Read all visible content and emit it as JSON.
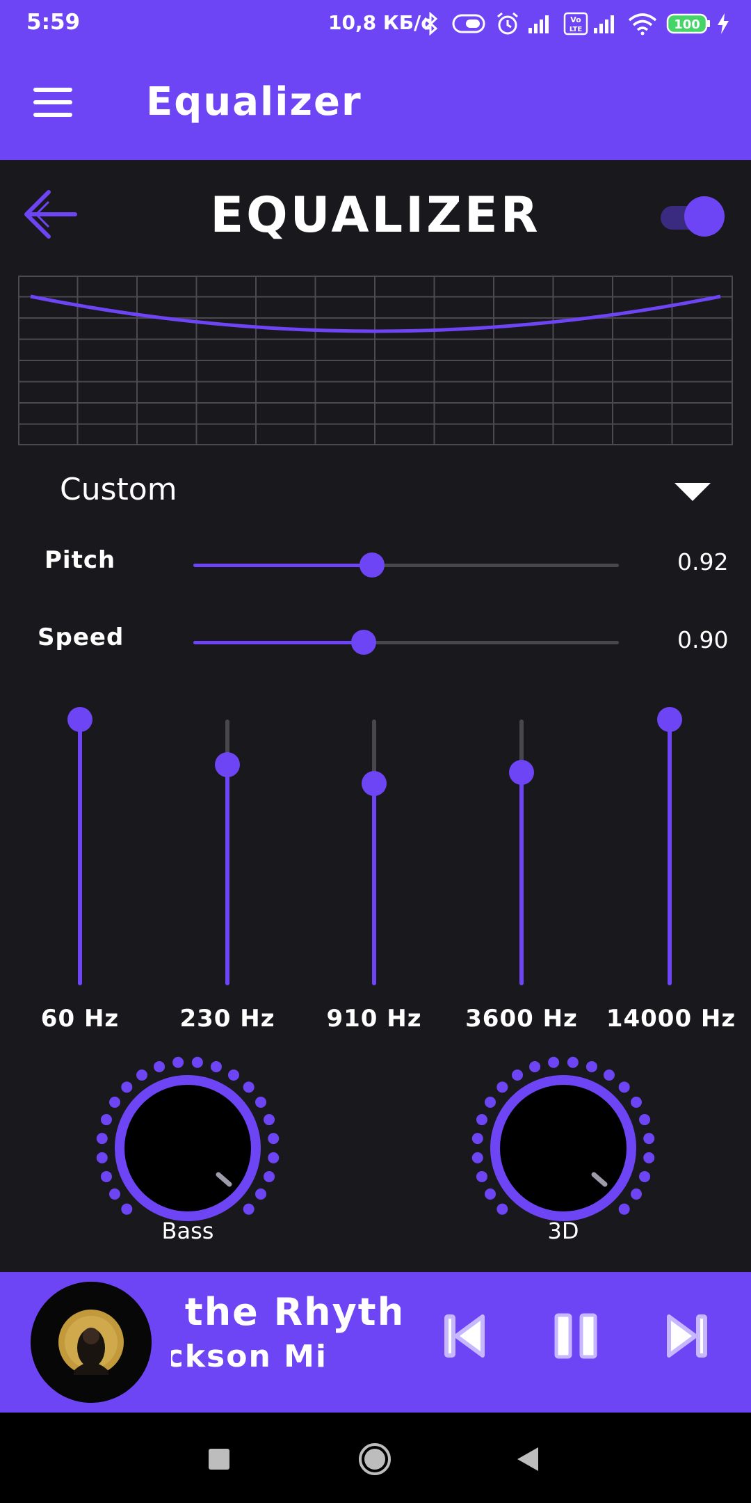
{
  "status_bar": {
    "time": "5:59",
    "network_speed": "10,8 КБ/с",
    "volte_label": "Vo LTE",
    "battery": "100"
  },
  "app_bar": {
    "title": "Equalizer",
    "menu_icon": "hamburger-menu-icon"
  },
  "equalizer": {
    "title": "EQUALIZER",
    "enabled": true,
    "preset": "Custom",
    "pitch": {
      "label": "Pitch",
      "value": "0.92",
      "fraction": 0.42
    },
    "speed": {
      "label": "Speed",
      "value": "0.90",
      "fraction": 0.4
    },
    "bands": [
      {
        "label": "60 Hz",
        "level": 1.0
      },
      {
        "label": "230 Hz",
        "level": 0.83
      },
      {
        "label": "910 Hz",
        "level": 0.76
      },
      {
        "label": "3600 Hz",
        "level": 0.8
      },
      {
        "label": "14000 Hz",
        "level": 1.0
      }
    ],
    "knobs": [
      {
        "label": "Bass"
      },
      {
        "label": "3D"
      }
    ]
  },
  "player": {
    "track_title": "o the Rhyth",
    "track_artist": "ackson     Mi",
    "is_playing": true
  },
  "colors": {
    "accent": "#6e45f5",
    "background": "#19181d",
    "track": "#48474d"
  }
}
